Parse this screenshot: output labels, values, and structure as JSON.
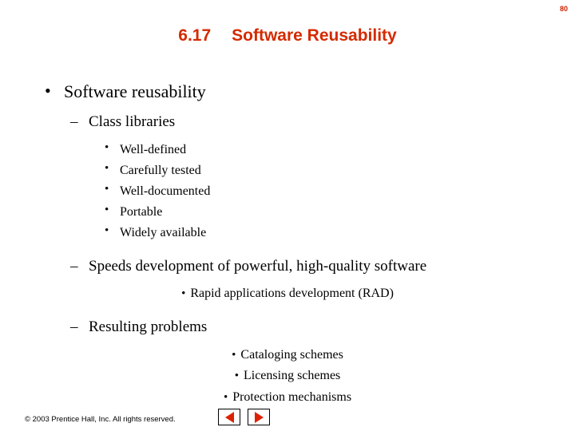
{
  "page_number": "80",
  "title": {
    "section_number": "6.17",
    "text": "Software Reusability"
  },
  "colors": {
    "title": "#d42a00",
    "page_number": "#cc2200",
    "nav_arrow": "#dd2200",
    "text": "#000000"
  },
  "content": {
    "level1": "Software reusability",
    "level2_a": "Class libraries",
    "level3_a": [
      "Well-defined",
      "Carefully tested",
      "Well-documented",
      "Portable",
      "Widely available"
    ],
    "level2_b": "Speeds development of powerful, high-quality software",
    "level3_b": "Rapid applications development (RAD)",
    "level2_c": "Resulting problems",
    "level3_c": [
      "Cataloging schemes",
      "Licensing schemes",
      "Protection mechanisms"
    ]
  },
  "bullets": {
    "disc": "•",
    "dash": "–"
  },
  "footer": {
    "copyright": "© 2003 Prentice Hall, Inc. All rights reserved.",
    "prev_label": "previous-slide",
    "next_label": "next-slide"
  }
}
